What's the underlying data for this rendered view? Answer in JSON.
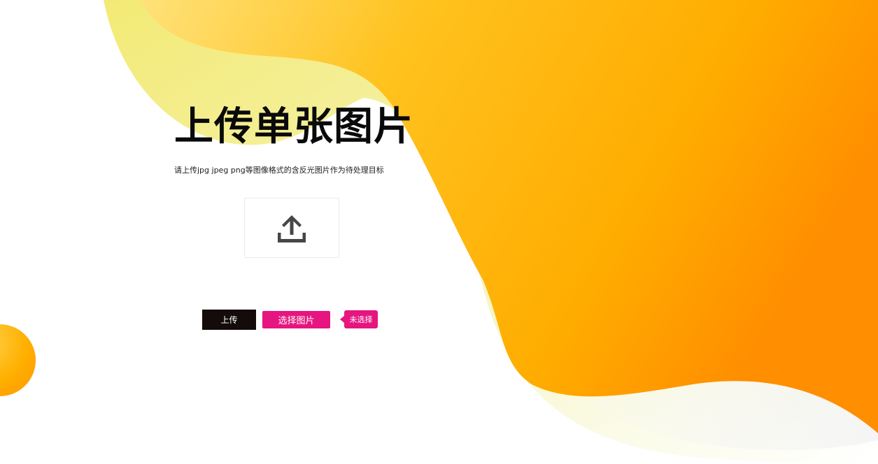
{
  "page": {
    "title": "上传单张图片",
    "subtitle": "请上传jpg jpeg png等图像格式的含反光图片作为待处理目标"
  },
  "upload_area": {
    "icon": "upload-icon"
  },
  "actions": {
    "upload_label": "上传",
    "choose_label": "选择图片",
    "file_status": "未选择"
  },
  "colors": {
    "accent": "#e6157f",
    "dark_button": "#140c0a",
    "orange": "#ff9a00",
    "yellow": "#f4ee8a"
  }
}
